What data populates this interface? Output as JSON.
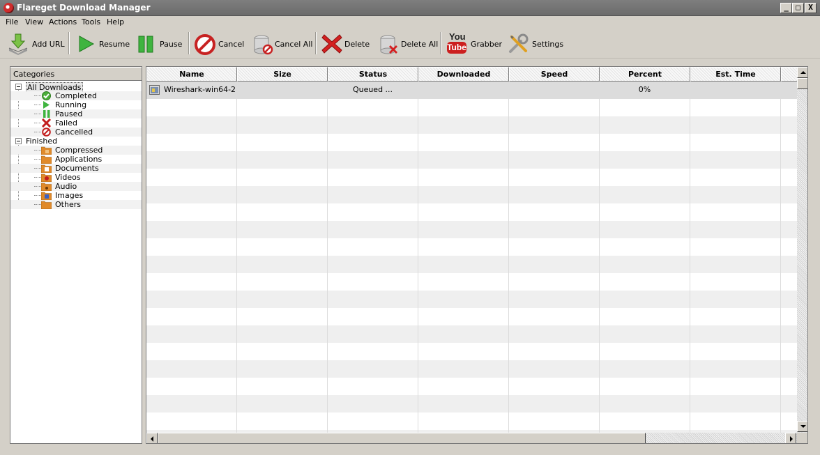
{
  "window": {
    "title": "Flareget Download Manager",
    "min_label": "_",
    "max_label": "□",
    "close_label": "X"
  },
  "menu": [
    "File",
    "View",
    "Actions",
    "Tools",
    "Help"
  ],
  "toolbar": {
    "add_url": "Add URL",
    "resume": "Resume",
    "pause": "Pause",
    "cancel": "Cancel",
    "cancel_all": "Cancel All",
    "delete": "Delete",
    "delete_all": "Delete All",
    "grabber": "Grabber",
    "grabber_icon_top": "You",
    "grabber_icon_bottom": "Tube",
    "settings": "Settings"
  },
  "sidebar": {
    "header": "Categories",
    "all_downloads": "All Downloads",
    "status_items": [
      "Completed",
      "Running",
      "Paused",
      "Failed",
      "Cancelled"
    ],
    "finished": "Finished",
    "finished_items": [
      "Compressed",
      "Applications",
      "Documents",
      "Videos",
      "Audio",
      "Images",
      "Others"
    ]
  },
  "table": {
    "columns": [
      "Name",
      "Size",
      "Status",
      "Downloaded",
      "Speed",
      "Percent",
      "Est. Time"
    ],
    "rows": [
      {
        "name": "Wireshark-win64-2...",
        "size": "",
        "status": "Queued ...",
        "downloaded": "",
        "speed": "",
        "percent": "0%",
        "est_time": ""
      }
    ]
  },
  "colors": {
    "chrome": "#d4d0c8",
    "titlebar": "#707070",
    "alt_row": "#efefef",
    "youtube_red": "#cc1f1f"
  },
  "icons": {
    "add_url": "download-arrow-icon",
    "resume": "play-icon",
    "pause": "pause-icon",
    "cancel": "cancel-circle-icon",
    "cancel_all": "cancel-all-icon",
    "delete": "red-x-icon",
    "delete_all": "delete-all-icon",
    "grabber": "youtube-icon",
    "settings": "tools-icon"
  }
}
